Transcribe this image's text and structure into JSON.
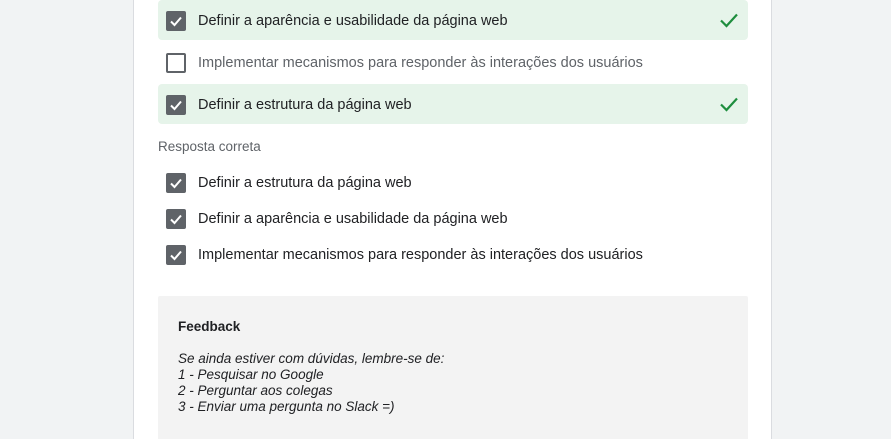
{
  "options": [
    {
      "label": "Definir a aparência e usabilidade da página web",
      "checked": true,
      "correct": true
    },
    {
      "label": "Implementar mecanismos para responder às interações dos usuários",
      "checked": false,
      "correct": false
    },
    {
      "label": "Definir a estrutura da página web",
      "checked": true,
      "correct": true
    }
  ],
  "correct_answer": {
    "heading": "Resposta correta",
    "items": [
      {
        "label": "Definir a estrutura da página web",
        "checked": true
      },
      {
        "label": "Definir a aparência e usabilidade da página web",
        "checked": true
      },
      {
        "label": "Implementar mecanismos para responder às interações dos usuários",
        "checked": true
      }
    ]
  },
  "feedback": {
    "title": "Feedback",
    "lines": [
      "Se ainda estiver com dúvidas, lembre-se de:",
      "1 - Pesquisar no Google",
      "2 - Perguntar aos colegas",
      "3 - Enviar uma pergunta no Slack =)"
    ]
  },
  "colors": {
    "correct_bg": "#e6f4ea",
    "correct_tick": "#1e8e3e",
    "checkbox": "#5f6368",
    "feedback_bg": "#f3f3f3"
  }
}
